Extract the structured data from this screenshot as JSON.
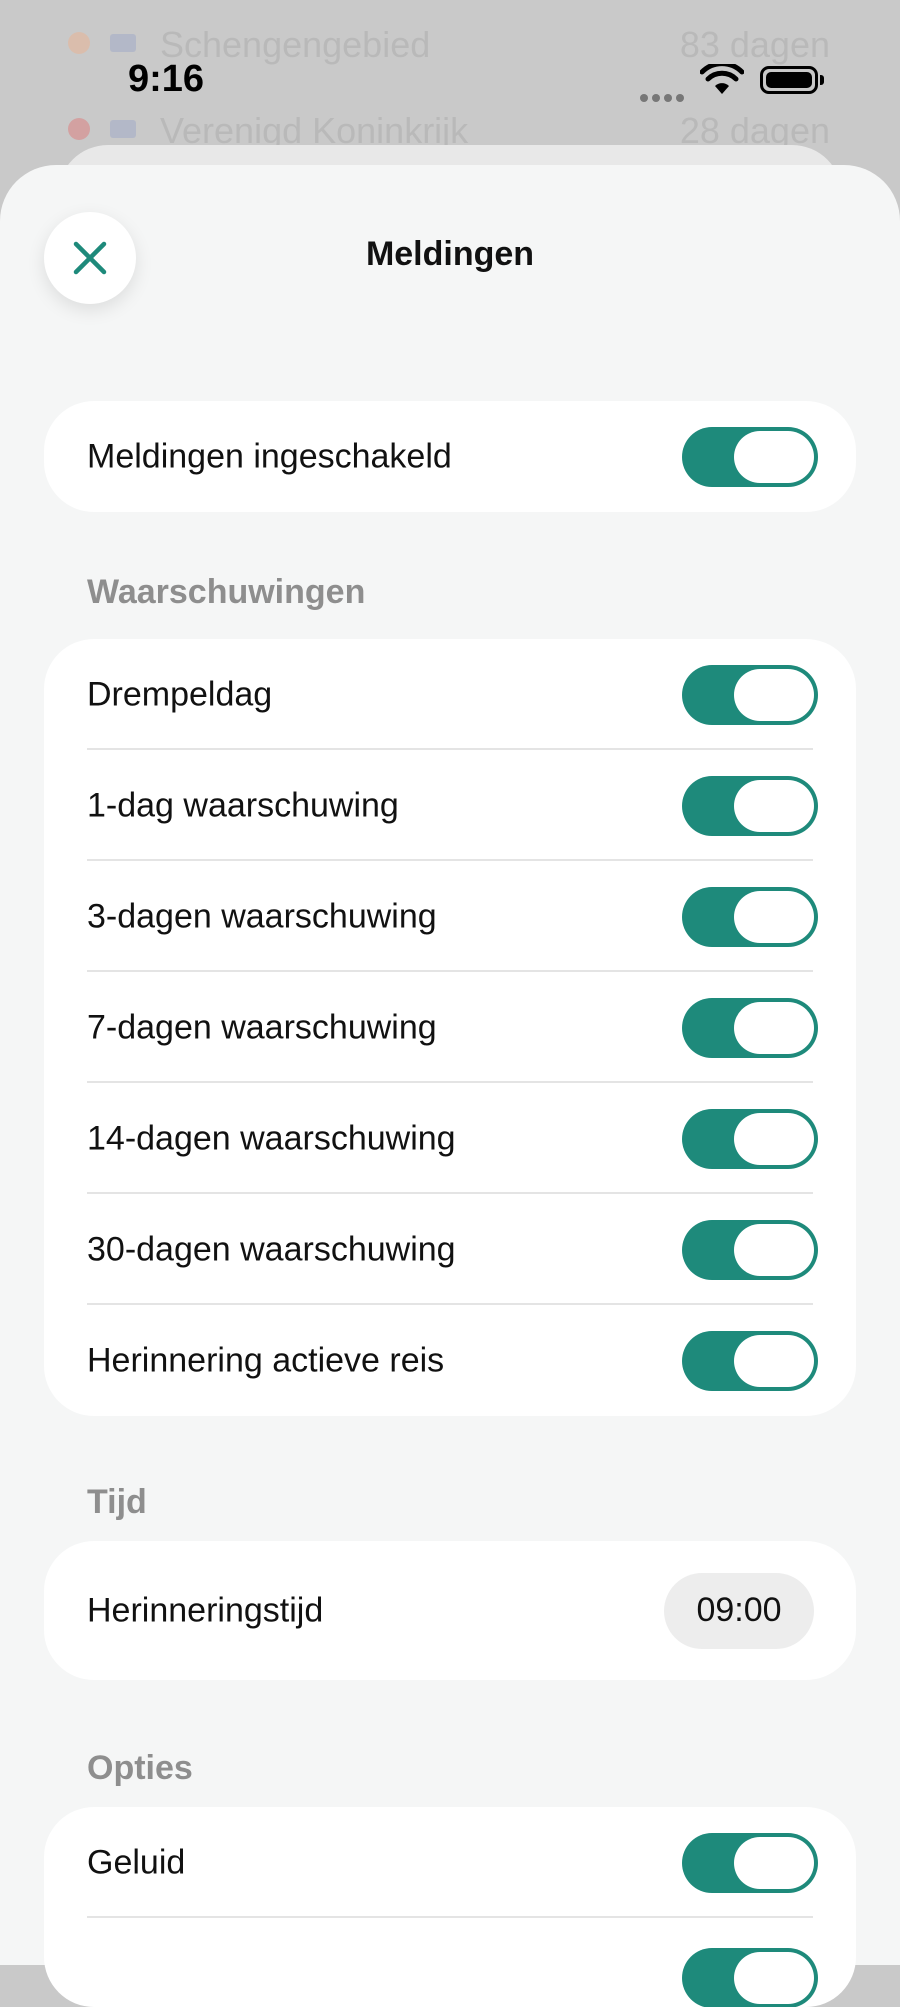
{
  "background_list": [
    {
      "name": "Schengengebied",
      "days": "83 dagen",
      "dot_color": "#f0b08a"
    },
    {
      "name": "Verenigd Koninkrijk",
      "days": "28 dagen",
      "dot_color": "#e07070"
    }
  ],
  "status_bar": {
    "time": "9:16"
  },
  "sheet": {
    "title": "Meldingen",
    "close_icon": "close-icon"
  },
  "main_toggle": {
    "label": "Meldingen ingeschakeld",
    "on": true
  },
  "warnings": {
    "header": "Waarschuwingen",
    "items": [
      {
        "label": "Drempeldag",
        "on": true
      },
      {
        "label": "1-dag waarschuwing",
        "on": true
      },
      {
        "label": "3-dagen waarschuwing",
        "on": true
      },
      {
        "label": "7-dagen waarschuwing",
        "on": true
      },
      {
        "label": "14-dagen waarschuwing",
        "on": true
      },
      {
        "label": "30-dagen waarschuwing",
        "on": true
      },
      {
        "label": "Herinnering actieve reis",
        "on": true
      }
    ]
  },
  "time_section": {
    "header": "Tijd",
    "label": "Herinneringstijd",
    "value": "09:00"
  },
  "options": {
    "header": "Opties",
    "items": [
      {
        "label": "Geluid",
        "on": true
      },
      {
        "label": "",
        "on": true
      }
    ]
  },
  "colors": {
    "accent": "#1e8a7b",
    "sheet_bg": "#f5f6f6",
    "section_header": "#8e8e8e"
  }
}
